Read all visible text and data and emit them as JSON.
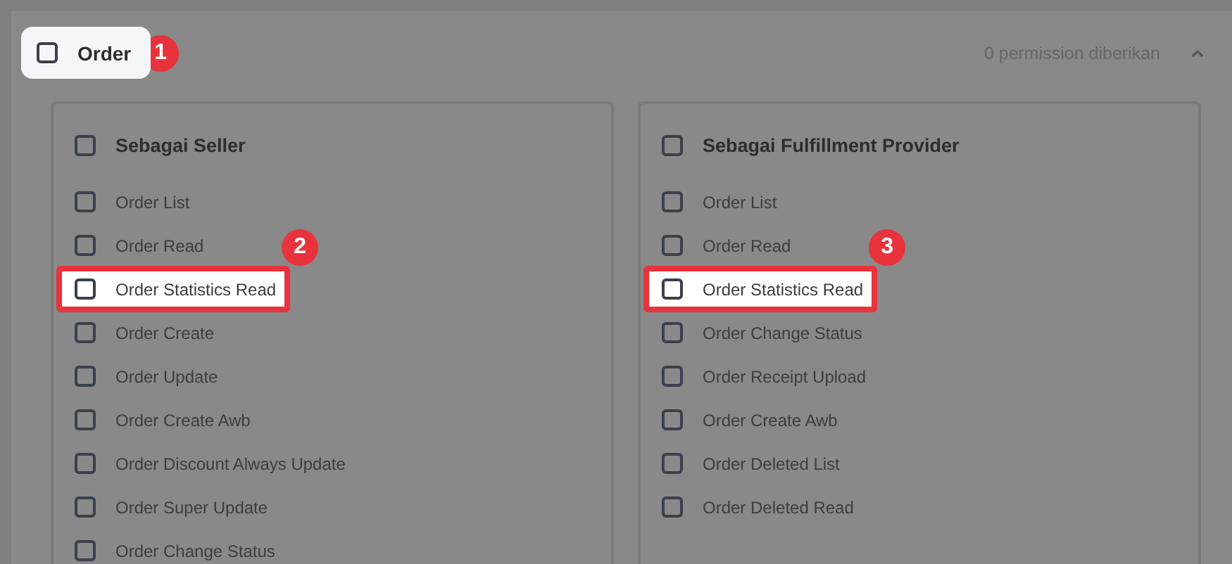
{
  "section": {
    "label": "Order",
    "checked": false,
    "highlighted": true,
    "callout": "1",
    "summary": "0 permission diberikan",
    "expanded": true
  },
  "groups": [
    {
      "title": "Sebagai Seller",
      "checked": false,
      "items": [
        {
          "label": "Order List",
          "checked": false,
          "highlighted": false
        },
        {
          "label": "Order Read",
          "checked": false,
          "highlighted": false
        },
        {
          "label": "Order Statistics Read",
          "checked": false,
          "highlighted": true,
          "callout": "2"
        },
        {
          "label": "Order Create",
          "checked": false,
          "highlighted": false
        },
        {
          "label": "Order Update",
          "checked": false,
          "highlighted": false
        },
        {
          "label": "Order Create Awb",
          "checked": false,
          "highlighted": false
        },
        {
          "label": "Order Discount Always Update",
          "checked": false,
          "highlighted": false
        },
        {
          "label": "Order Super Update",
          "checked": false,
          "highlighted": false
        },
        {
          "label": "Order Change Status",
          "checked": false,
          "highlighted": false
        }
      ]
    },
    {
      "title": "Sebagai Fulfillment Provider",
      "checked": false,
      "items": [
        {
          "label": "Order List",
          "checked": false,
          "highlighted": false
        },
        {
          "label": "Order Read",
          "checked": false,
          "highlighted": false
        },
        {
          "label": "Order Statistics Read",
          "checked": false,
          "highlighted": true,
          "callout": "3"
        },
        {
          "label": "Order Change Status",
          "checked": false,
          "highlighted": false
        },
        {
          "label": "Order Receipt Upload",
          "checked": false,
          "highlighted": false
        },
        {
          "label": "Order Create Awb",
          "checked": false,
          "highlighted": false
        },
        {
          "label": "Order Deleted List",
          "checked": false,
          "highlighted": false
        },
        {
          "label": "Order Deleted Read",
          "checked": false,
          "highlighted": false
        }
      ]
    }
  ]
}
